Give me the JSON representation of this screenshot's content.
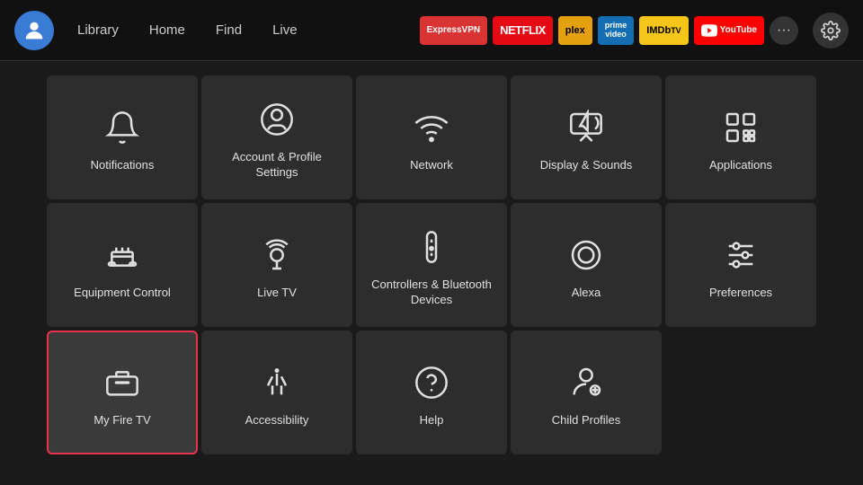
{
  "nav": {
    "links": [
      "Library",
      "Home",
      "Find",
      "Live"
    ],
    "apps": [
      {
        "label": "ExpressVPN",
        "class": "app-expressvpn"
      },
      {
        "label": "NETFLIX",
        "class": "app-netflix"
      },
      {
        "label": "plex",
        "class": "app-plex"
      },
      {
        "label": "prime video",
        "class": "app-prime"
      },
      {
        "label": "IMDbTV",
        "class": "app-imdb"
      },
      {
        "label": "▶ YouTube",
        "class": "app-youtube"
      }
    ],
    "more_label": "···",
    "settings_label": "⚙"
  },
  "tiles": [
    {
      "id": "notifications",
      "label": "Notifications",
      "icon": "bell"
    },
    {
      "id": "account-profile",
      "label": "Account & Profile Settings",
      "icon": "person-circle"
    },
    {
      "id": "network",
      "label": "Network",
      "icon": "wifi"
    },
    {
      "id": "display-sounds",
      "label": "Display & Sounds",
      "icon": "display-sound"
    },
    {
      "id": "applications",
      "label": "Applications",
      "icon": "applications"
    },
    {
      "id": "equipment-control",
      "label": "Equipment Control",
      "icon": "tv-remote"
    },
    {
      "id": "live-tv",
      "label": "Live TV",
      "icon": "antenna"
    },
    {
      "id": "controllers-bluetooth",
      "label": "Controllers & Bluetooth Devices",
      "icon": "remote"
    },
    {
      "id": "alexa",
      "label": "Alexa",
      "icon": "alexa"
    },
    {
      "id": "preferences",
      "label": "Preferences",
      "icon": "sliders"
    },
    {
      "id": "my-fire-tv",
      "label": "My Fire TV",
      "icon": "fire-tv",
      "selected": true
    },
    {
      "id": "accessibility",
      "label": "Accessibility",
      "icon": "accessibility"
    },
    {
      "id": "help",
      "label": "Help",
      "icon": "help"
    },
    {
      "id": "child-profiles",
      "label": "Child Profiles",
      "icon": "child-profile"
    }
  ]
}
